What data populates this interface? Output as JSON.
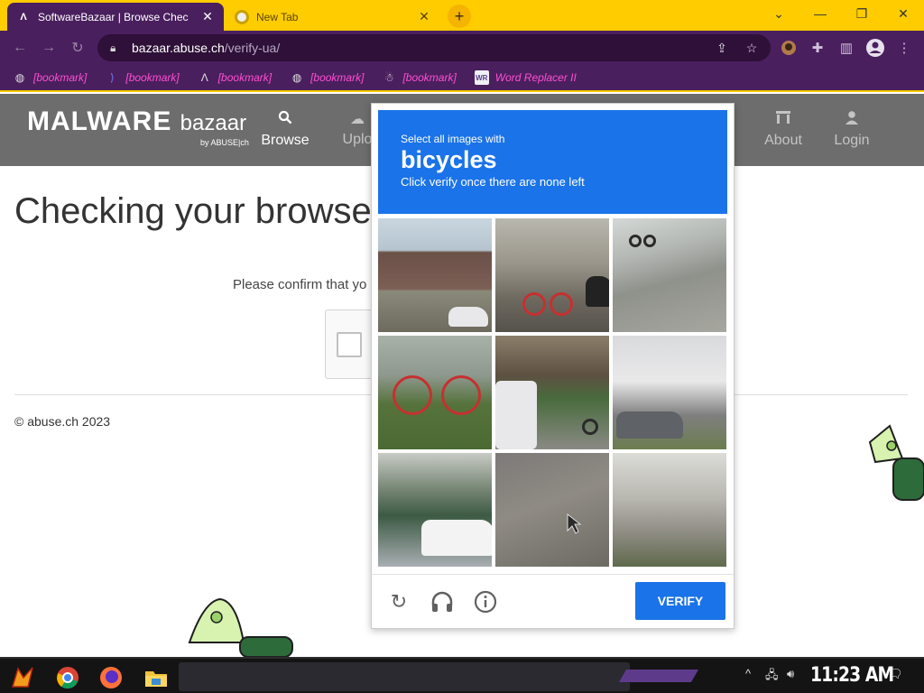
{
  "browser": {
    "tabs": [
      {
        "title": "SoftwareBazaar | Browse Chec",
        "favicon": "abuse-ch-logo-icon",
        "active": true
      },
      {
        "title": "New Tab",
        "favicon": "chrome-icon",
        "active": false
      }
    ],
    "new_tab_label": "+",
    "url_host": "bazaar.abuse.ch",
    "url_path": "/verify-ua/",
    "bookmarks": [
      {
        "label": "[bookmark]",
        "icon": "globe-icon"
      },
      {
        "label": "[bookmark]",
        "icon": "bookmark-icon"
      },
      {
        "label": "[bookmark]",
        "icon": "abuse-ch-logo-icon"
      },
      {
        "label": "[bookmark]",
        "icon": "globe-icon"
      },
      {
        "label": "[bookmark]",
        "icon": "ghost-icon"
      },
      {
        "label": "Word Replacer II",
        "icon": "extension-icon"
      }
    ],
    "colors": {
      "tabstrip": "#ffcc00",
      "toolbar": "#4a1f5e",
      "bookmark_text": "#ff4fd2"
    }
  },
  "site": {
    "logo_main": "MALWARE",
    "logo_sub": "bazaar",
    "logo_by": "by ABUSE|ch",
    "nav": [
      {
        "label": "Browse",
        "icon": "search-icon"
      },
      {
        "label": "Uplo",
        "icon": "upload-cloud-icon"
      },
      {
        "label": "About",
        "icon": "building-icon"
      },
      {
        "label": "Login",
        "icon": "user-icon"
      }
    ],
    "heading": "Checking your browser",
    "confirm_text": "Please confirm that yo",
    "footer": "© abuse.ch 2023"
  },
  "captcha": {
    "instruction_line1": "Select all images with",
    "instruction_target": "bicycles",
    "instruction_line3": "Click verify once there are none left",
    "verify_label": "VERIFY",
    "controls": [
      "reload-icon",
      "audio-headphones-icon",
      "info-icon"
    ],
    "tiles": [
      {
        "index": 1
      },
      {
        "index": 2
      },
      {
        "index": 3
      },
      {
        "index": 4
      },
      {
        "index": 5
      },
      {
        "index": 6
      },
      {
        "index": 7
      },
      {
        "index": 8
      },
      {
        "index": 9
      }
    ],
    "colors": {
      "banner": "#1a73e8",
      "verify": "#1a73e8"
    }
  },
  "taskbar": {
    "clock": "11:23 AM"
  }
}
